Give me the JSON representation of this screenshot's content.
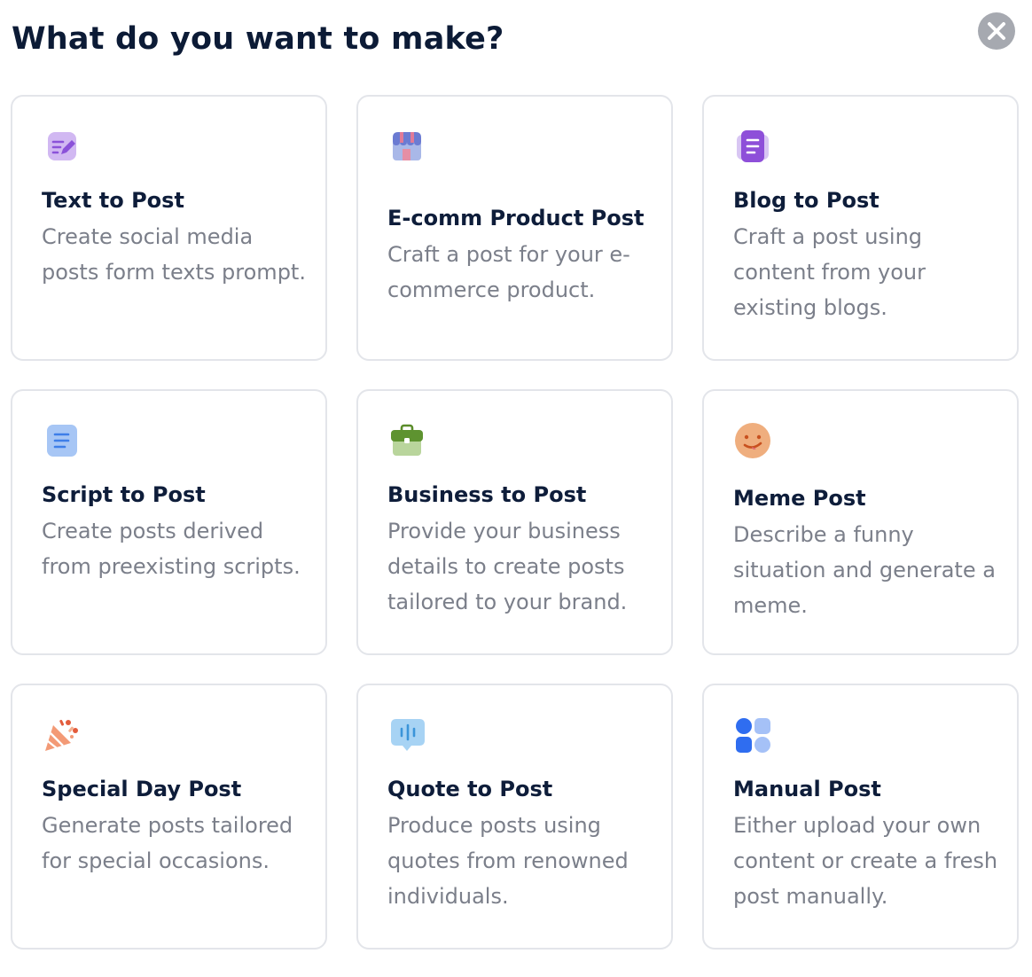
{
  "header": {
    "title": "What do you want to make?"
  },
  "close": {
    "icon": "close-icon",
    "color": "#a6a9b0"
  },
  "options": [
    {
      "icon": "edit-note-icon",
      "title": "Text to Post",
      "description": "Create social media posts form texts prompt."
    },
    {
      "icon": "storefront-icon",
      "title": "E-comm Product Post",
      "description": "Craft a post for your e-commerce product."
    },
    {
      "icon": "blog-document-icon",
      "title": "Blog to Post",
      "description": "Craft a post using content from your existing blogs."
    },
    {
      "icon": "script-lines-icon",
      "title": "Script to Post",
      "description": "Create posts derived from preexisting scripts."
    },
    {
      "icon": "briefcase-icon",
      "title": "Business to Post",
      "description": "Provide your business details to create posts tailored to your brand."
    },
    {
      "icon": "smiley-face-icon",
      "title": "Meme Post",
      "description": "Describe a funny situation and generate a meme."
    },
    {
      "icon": "party-popper-icon",
      "title": "Special Day Post",
      "description": "Generate posts tailored for special occasions."
    },
    {
      "icon": "quote-bubble-icon",
      "title": "Quote to Post",
      "description": "Produce posts using quotes from renowned individuals."
    },
    {
      "icon": "apps-grid-icon",
      "title": "Manual Post",
      "description": "Either upload your own content or create a fresh post manually."
    }
  ]
}
